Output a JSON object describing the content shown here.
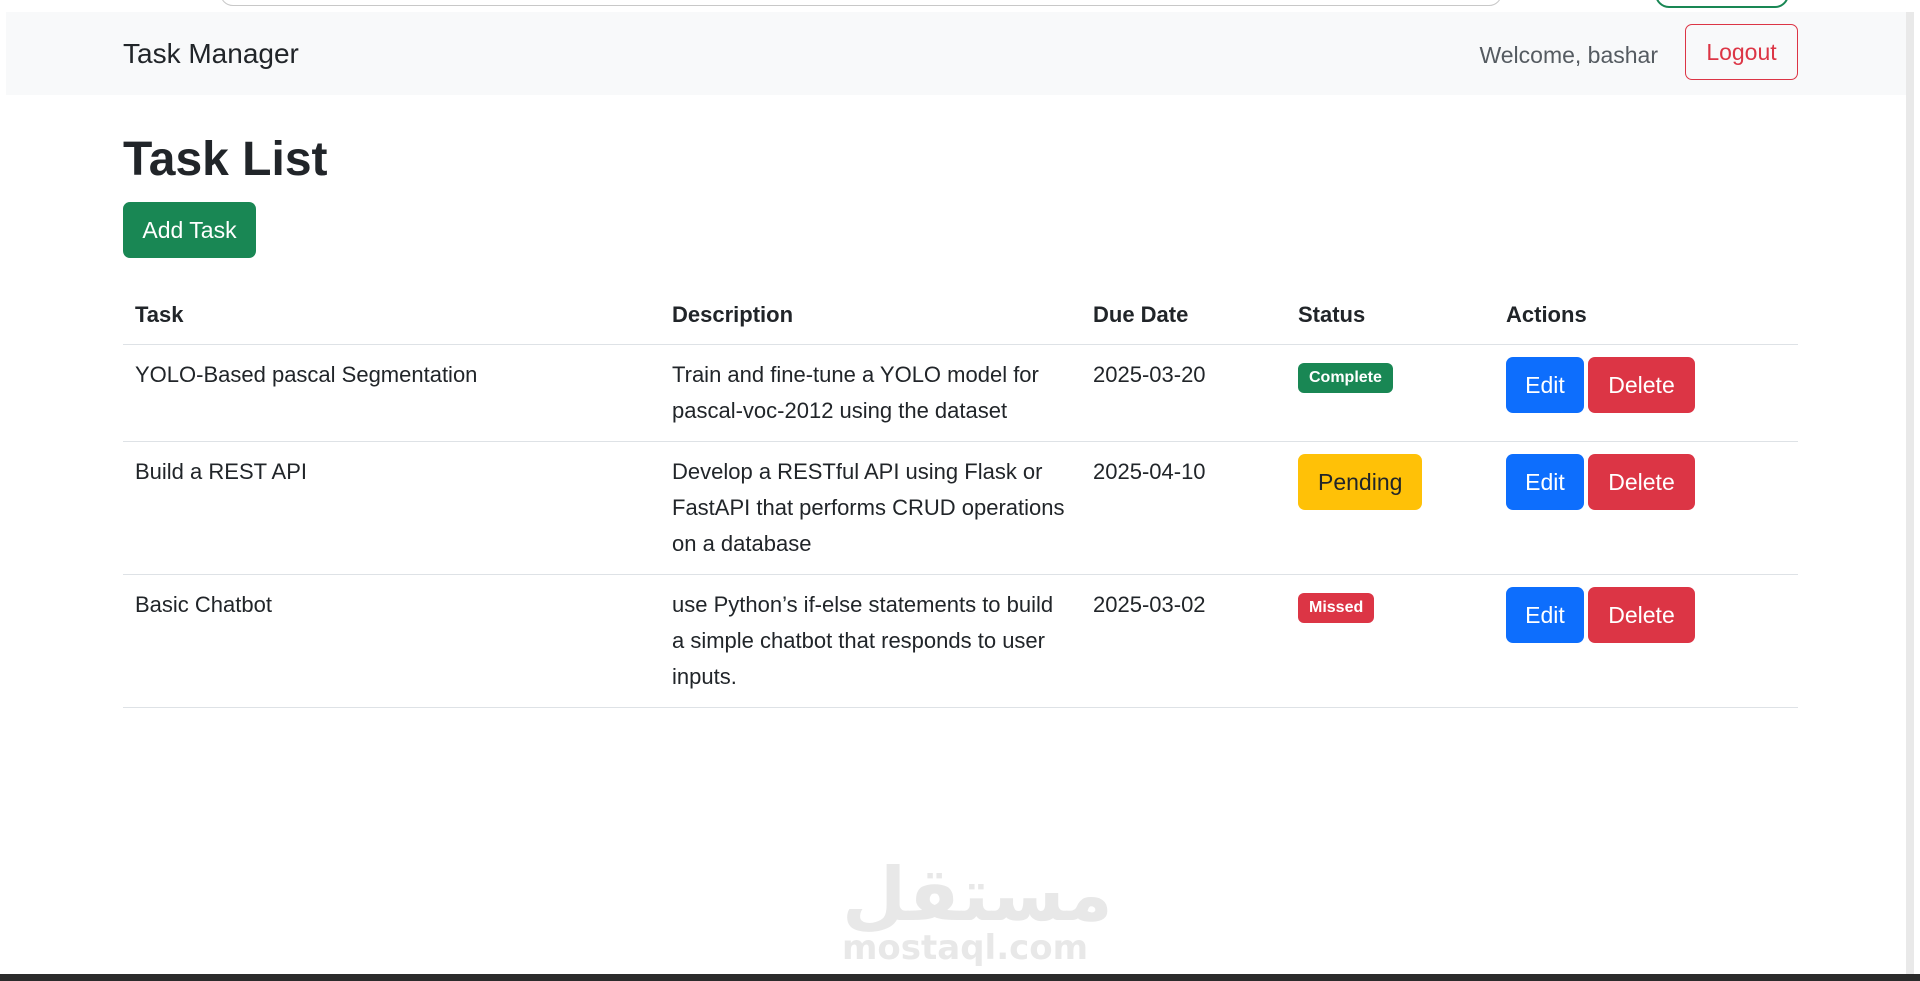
{
  "navbar": {
    "brand": "Task Manager",
    "welcome": "Welcome, bashar",
    "logout_label": "Logout"
  },
  "main": {
    "title": "Task List",
    "add_task_label": "Add Task",
    "table": {
      "headers": [
        "Task",
        "Description",
        "Due Date",
        "Status",
        "Actions"
      ],
      "rows": [
        {
          "task": "YOLO-Based pascal Segmentation",
          "description": "Train and fine-tune a YOLO model for pascal-voc-2012 using the dataset",
          "due_date": "2025-03-20",
          "status": "Complete",
          "edit_label": "Edit",
          "delete_label": "Delete"
        },
        {
          "task": "Build a REST API",
          "description": "Develop a RESTful API using Flask or FastAPI that performs CRUD operations on a database",
          "due_date": "2025-04-10",
          "status": "Pending",
          "edit_label": "Edit",
          "delete_label": "Delete"
        },
        {
          "task": "Basic Chatbot",
          "description": "use Python’s if-else statements to build a simple chatbot that responds to user inputs.",
          "due_date": "2025-03-02",
          "status": "Missed",
          "edit_label": "Edit",
          "delete_label": "Delete"
        }
      ]
    }
  },
  "watermark": {
    "arabic": "مستقل",
    "latin": "mostaql.com"
  },
  "colors": {
    "success": "#198754",
    "danger": "#dc3545",
    "primary": "#0d6efd",
    "warning": "#ffc107",
    "navbar_bg": "#f8f9fa"
  }
}
